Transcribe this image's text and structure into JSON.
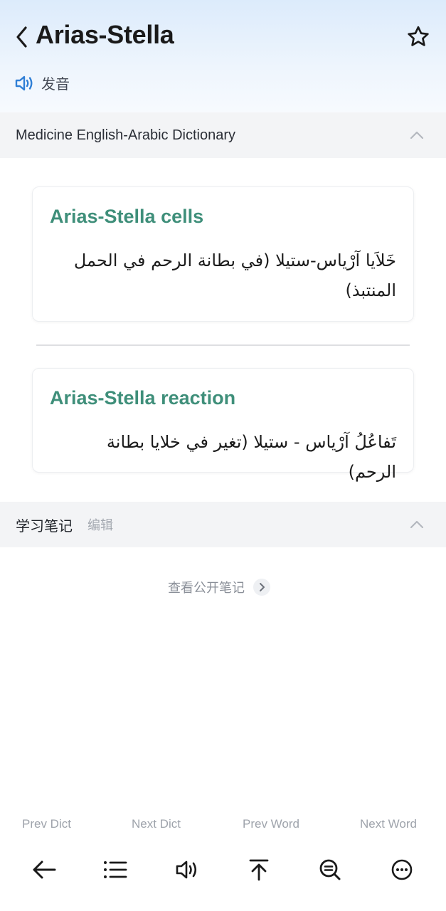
{
  "header": {
    "word": "Arias-Stella",
    "pronounce_label": "发音",
    "icons": {
      "back": "chevron-left-icon",
      "favorite": "star-icon",
      "speaker": "speaker-icon"
    }
  },
  "dictionary": {
    "name": "Medicine English-Arabic Dictionary",
    "entries": [
      {
        "term": "Arias-Stella cells",
        "definition": "خَلاَيا آرْياس-ستيلا (في بطانة الرحم في الحمل المنتبذ)"
      },
      {
        "term": "Arias-Stella reaction",
        "definition": "تَفاعُلُ آرْياس - ستيلا (تغير في خلايا بطانة الرحم)"
      }
    ]
  },
  "notes": {
    "title": "学习笔记",
    "edit_label": "编辑",
    "view_public_label": "查看公开笔记"
  },
  "bottom_nav": {
    "prev_dict": "Prev Dict",
    "next_dict": "Next Dict",
    "prev_word": "Prev Word",
    "next_word": "Next Word"
  },
  "toolbar": {
    "icons": [
      "arrow-left-icon",
      "list-icon",
      "speaker-icon",
      "scroll-to-top-icon",
      "search-zoom-icon",
      "more-icon"
    ]
  },
  "colors": {
    "accent_term": "#3f8f7a",
    "speaker_blue": "#2f7fd6",
    "header_gradient_top": "#dcebfb"
  }
}
